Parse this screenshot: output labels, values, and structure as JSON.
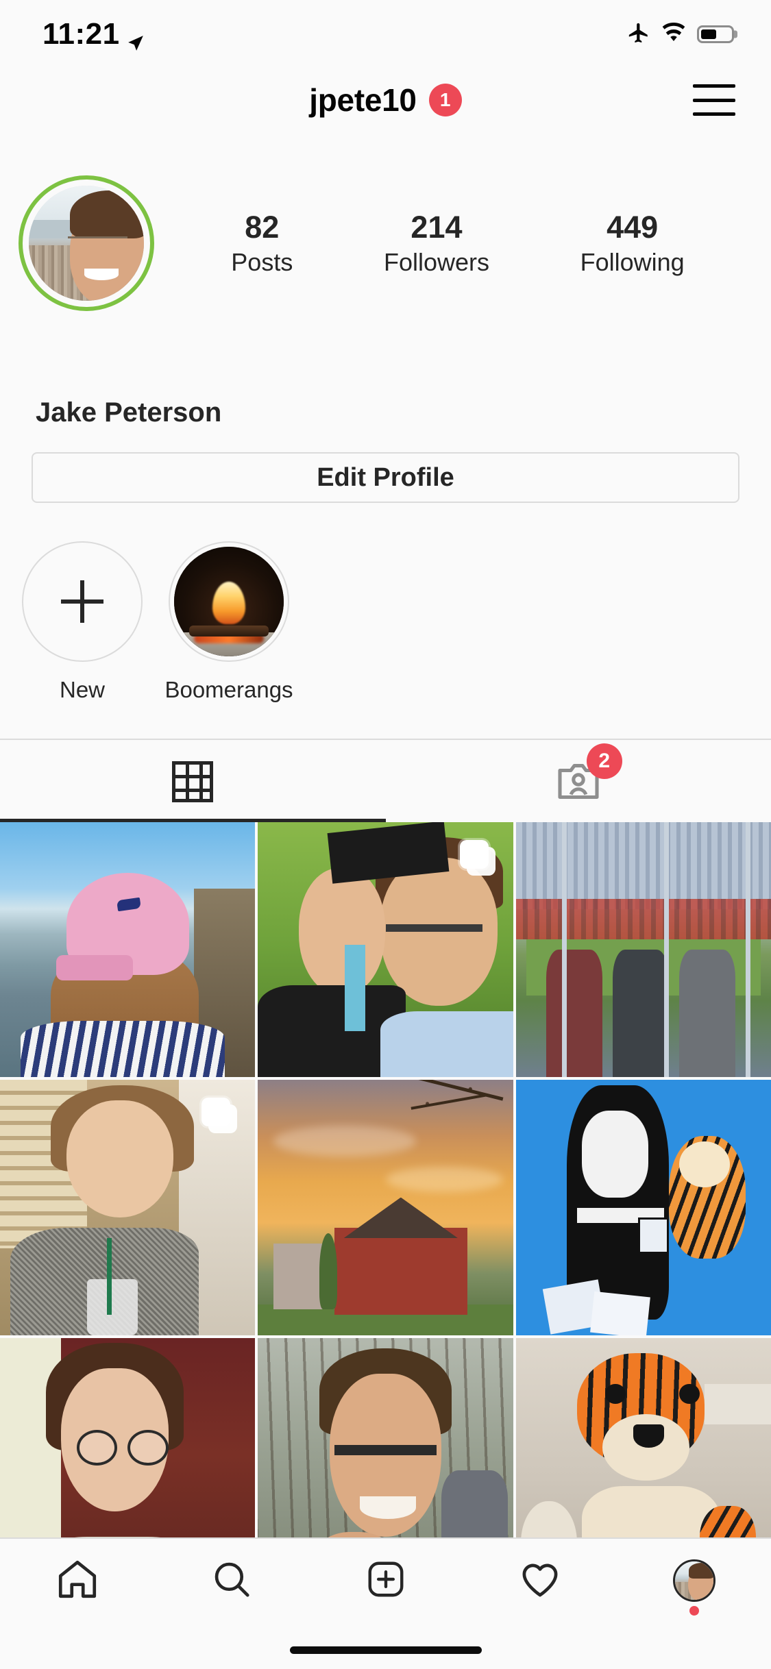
{
  "status_bar": {
    "time": "11:21",
    "location_icon": "location-arrow-icon",
    "airplane_icon": "airplane-mode-icon",
    "wifi_icon": "wifi-icon",
    "battery_icon": "battery-icon",
    "battery_level_percent": 52
  },
  "header": {
    "username": "jpete10",
    "badge_count": "1",
    "menu_icon": "hamburger-menu-icon"
  },
  "profile": {
    "avatar_alt": "profile-photo",
    "story_ring_color": "#7DC242",
    "full_name": "Jake Peterson",
    "stats": [
      {
        "value": "82",
        "label": "Posts"
      },
      {
        "value": "214",
        "label": "Followers"
      },
      {
        "value": "449",
        "label": "Following"
      }
    ]
  },
  "actions": {
    "edit_profile_label": "Edit Profile"
  },
  "highlights": [
    {
      "label": "New",
      "icon": "plus-icon",
      "type": "new"
    },
    {
      "label": "Boomerangs",
      "icon": "fireplace-thumbnail",
      "type": "highlight"
    }
  ],
  "tabs": [
    {
      "name": "grid",
      "icon": "grid-icon",
      "active": true,
      "badge": ""
    },
    {
      "name": "tagged",
      "icon": "tagged-person-icon",
      "active": false,
      "badge": "2"
    }
  ],
  "grid_posts": [
    {
      "id": "post-1",
      "alt": "woman in pink cap at beach",
      "art": "a-beach",
      "carousel": false
    },
    {
      "id": "post-2",
      "alt": "graduation selfie couple",
      "art": "a-grad",
      "carousel": true
    },
    {
      "id": "post-3",
      "alt": "three men at football stadium",
      "art": "a-stadium",
      "carousel": false
    },
    {
      "id": "post-4",
      "alt": "woman at coffee shop",
      "art": "a-coffee",
      "carousel": true
    },
    {
      "id": "post-5",
      "alt": "red house at sunset",
      "art": "a-sunset",
      "carousel": false
    },
    {
      "id": "post-6",
      "alt": "calvin and hobbes mural",
      "art": "a-mural",
      "carousel": false
    },
    {
      "id": "post-7",
      "alt": "woman with glasses",
      "art": "a-glasses",
      "carousel": false
    },
    {
      "id": "post-8",
      "alt": "couple selfie outdoors",
      "art": "a-selfie",
      "carousel": false
    },
    {
      "id": "post-9",
      "alt": "crochet tiger plush toy",
      "art": "a-tiger",
      "carousel": false
    }
  ],
  "bottom_nav": [
    {
      "name": "home",
      "icon": "home-icon"
    },
    {
      "name": "search",
      "icon": "search-icon"
    },
    {
      "name": "create",
      "icon": "add-post-icon"
    },
    {
      "name": "activity",
      "icon": "heart-icon"
    },
    {
      "name": "profile",
      "icon": "profile-avatar-icon",
      "has_dot": true
    }
  ],
  "colors": {
    "badge_red": "#ED4956",
    "text_primary": "#262626",
    "border": "#dbdbdb",
    "background": "#fafafa"
  }
}
